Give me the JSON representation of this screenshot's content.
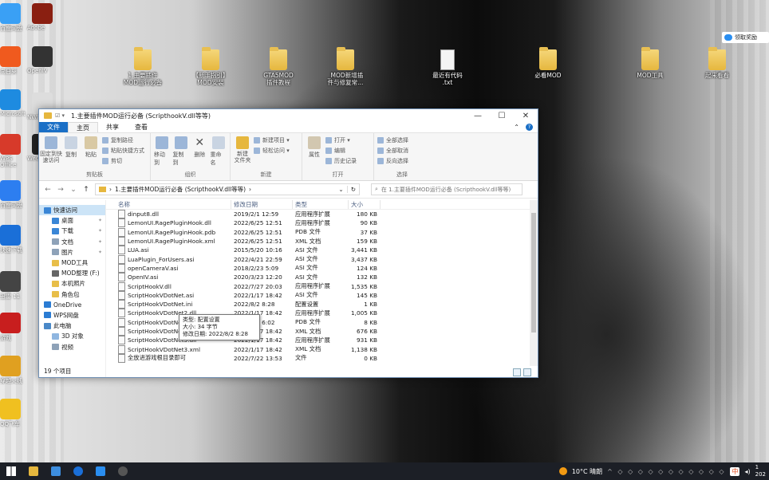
{
  "desktop": {
    "top_icons": [
      {
        "label": "1.主要插件\nMOD运行必备",
        "type": "folder"
      },
      {
        "label": "【新手指引】\nMOD安装",
        "type": "folder"
      },
      {
        "label": "GTA5MOD\n插件教程",
        "type": "folder"
      },
      {
        "label": "_MOD新增插\n件与修复常...",
        "type": "folder"
      },
      {
        "label": "最近有代码\n.txt",
        "type": "doc"
      },
      {
        "label": "必看MOD",
        "type": "folder"
      },
      {
        "label": "MOD工具",
        "type": "folder"
      },
      {
        "label": "起来看看",
        "type": "folder"
      }
    ],
    "left_icons": [
      {
        "label": "百度网盘",
        "color": "#3aa0f5"
      },
      {
        "label": "Adobe\nCC 2019",
        "color": "#8a1f11"
      },
      {
        "label": "向日葵",
        "color": "#f05a1e"
      },
      {
        "label": "OpenIV",
        "color": "#333333"
      },
      {
        "label": "Microsoft\nEdge",
        "color": "#1e8be0"
      },
      {
        "label": "NWP",
        "color": "#dddddd"
      },
      {
        "label": "WPS Office",
        "color": "#d73a2a"
      },
      {
        "label": "WeGame",
        "color": "#222222"
      },
      {
        "label": "百度网盘",
        "color": "#2d7ef0"
      },
      {
        "label": "快速下载",
        "color": "#1a6fd8"
      },
      {
        "label": "迅雷 11",
        "color": "#444444"
      },
      {
        "label": "游戏",
        "color": "#c81e1e"
      },
      {
        "label": "穿越火线",
        "color": "#e0a020"
      },
      {
        "label": "QQ飞车",
        "color": "#f0c020"
      }
    ]
  },
  "cloud_button": "领取奖励",
  "window": {
    "title": "1.主要插件MOD运行必备 (ScripthookV.dll等等)",
    "controls": {
      "minimize": "—",
      "maximize": "☐",
      "close": "✕"
    },
    "menu": [
      "文件",
      "主页",
      "共享",
      "查看"
    ],
    "ribbon": {
      "clipboard": {
        "label": "剪贴板",
        "pin": "固定到快\n速访问",
        "copy": "复制",
        "paste": "粘贴",
        "cut_path": "复制路径",
        "paste_shortcut": "粘贴快捷方式",
        "cut": "剪切"
      },
      "organize": {
        "label": "组织",
        "move_to": "移动到",
        "copy_to": "复制到",
        "delete": "删除",
        "rename": "重命名"
      },
      "new": {
        "label": "新建",
        "new_folder": "新建\n文件夹",
        "new_item": "新建项目 ▾",
        "easy_access": "轻松访问 ▾"
      },
      "open": {
        "label": "打开",
        "properties": "属性",
        "open": "打开 ▾",
        "edit": "编辑",
        "history": "历史记录"
      },
      "select": {
        "label": "选择",
        "select_all": "全部选择",
        "select_none": "全部取消",
        "invert": "反向选择"
      }
    },
    "address": {
      "path": "1.主要插件MOD运行必备 (ScripthookV.dll等等)",
      "search_placeholder": "在 1.主要插件MOD运行必备 (ScripthookV.dll等等)"
    },
    "nav_pane": [
      {
        "label": "快速访问",
        "indent": false,
        "selected": true,
        "color": "#3a86d6"
      },
      {
        "label": "桌面",
        "indent": true,
        "pin": true,
        "color": "#3a86d6"
      },
      {
        "label": "下载",
        "indent": true,
        "pin": true,
        "color": "#3a86d6"
      },
      {
        "label": "文档",
        "indent": true,
        "pin": true,
        "color": "#8ea2b8"
      },
      {
        "label": "图片",
        "indent": true,
        "pin": true,
        "color": "#8ea2b8"
      },
      {
        "label": "MOD工具",
        "indent": true,
        "color": "#e8be48"
      },
      {
        "label": "MOD整理 (F:)",
        "indent": true,
        "color": "#666666"
      },
      {
        "label": "本机照片",
        "indent": true,
        "color": "#e8be48"
      },
      {
        "label": "角色包",
        "indent": true,
        "color": "#e8be48"
      },
      {
        "label": "OneDrive",
        "indent": false,
        "color": "#2b7cd3"
      },
      {
        "label": "WPS网盘",
        "indent": false,
        "color": "#2b7cd3"
      },
      {
        "label": "此电脑",
        "indent": false,
        "color": "#4a89c8"
      },
      {
        "label": "3D 对象",
        "indent": true,
        "color": "#8fb6e0"
      },
      {
        "label": "视频",
        "indent": true,
        "color": "#8ea2b8"
      }
    ],
    "status": "19 个项目",
    "columns": [
      "名称",
      "修改日期",
      "类型",
      "大小"
    ],
    "files": [
      {
        "name": "dinput8.dll",
        "date": "2019/2/1 12:59",
        "type": "应用程序扩展",
        "size": "180 KB"
      },
      {
        "name": "LemonUI.RagePluginHook.dll",
        "date": "2022/6/25 12:51",
        "type": "应用程序扩展",
        "size": "90 KB"
      },
      {
        "name": "LemonUI.RagePluginHook.pdb",
        "date": "2022/6/25 12:51",
        "type": "PDB 文件",
        "size": "37 KB"
      },
      {
        "name": "LemonUI.RagePluginHook.xml",
        "date": "2022/6/25 12:51",
        "type": "XML 文档",
        "size": "159 KB"
      },
      {
        "name": "LUA.asi",
        "date": "2015/5/20 10:16",
        "type": "ASI 文件",
        "size": "3,441 KB"
      },
      {
        "name": "LuaPlugin_ForUsers.asi",
        "date": "2022/4/21 22:59",
        "type": "ASI 文件",
        "size": "3,437 KB"
      },
      {
        "name": "openCameraV.asi",
        "date": "2018/2/23 5:09",
        "type": "ASI 文件",
        "size": "124 KB"
      },
      {
        "name": "OpenIV.asi",
        "date": "2020/3/23 12:20",
        "type": "ASI 文件",
        "size": "132 KB"
      },
      {
        "name": "ScriptHookV.dll",
        "date": "2022/7/27 20:03",
        "type": "应用程序扩展",
        "size": "1,535 KB"
      },
      {
        "name": "ScriptHookVDotNet.asi",
        "date": "2022/1/17 18:42",
        "type": "ASI 文件",
        "size": "145 KB"
      },
      {
        "name": "ScriptHookVDotNet.ini",
        "date": "2022/8/2 8:28",
        "type": "配置设置",
        "size": "1 KB"
      },
      {
        "name": "ScriptHookVDotNet2.dll",
        "date": "2022/1/17 18:42",
        "type": "应用程序扩展",
        "size": "1,005 KB"
      },
      {
        "name": "ScriptHookVDotNet2.pdb",
        "date": "2019/8/6 6:02",
        "type": "PDB 文件",
        "size": "8 KB"
      },
      {
        "name": "ScriptHookVDotNet2.xml",
        "date": "2022/1/17 18:42",
        "type": "XML 文档",
        "size": "676 KB"
      },
      {
        "name": "ScriptHookVDotNet3.dll",
        "date": "2022/1/17 18:42",
        "type": "应用程序扩展",
        "size": "931 KB"
      },
      {
        "name": "ScriptHookVDotNet3.xml",
        "date": "2022/1/17 18:42",
        "type": "XML 文档",
        "size": "1,138 KB"
      },
      {
        "name": "全放进游戏根目录即可",
        "date": "2022/7/22 13:53",
        "type": "文件",
        "size": "0 KB"
      }
    ],
    "tooltip": {
      "type": "类型: 配置设置",
      "size": "大小: 34 字节",
      "modified": "修改日期: 2022/8/2 8:28"
    }
  },
  "taskbar": {
    "weather": "10°C 晴朗",
    "ime": "中",
    "time": "1",
    "date": "202"
  }
}
